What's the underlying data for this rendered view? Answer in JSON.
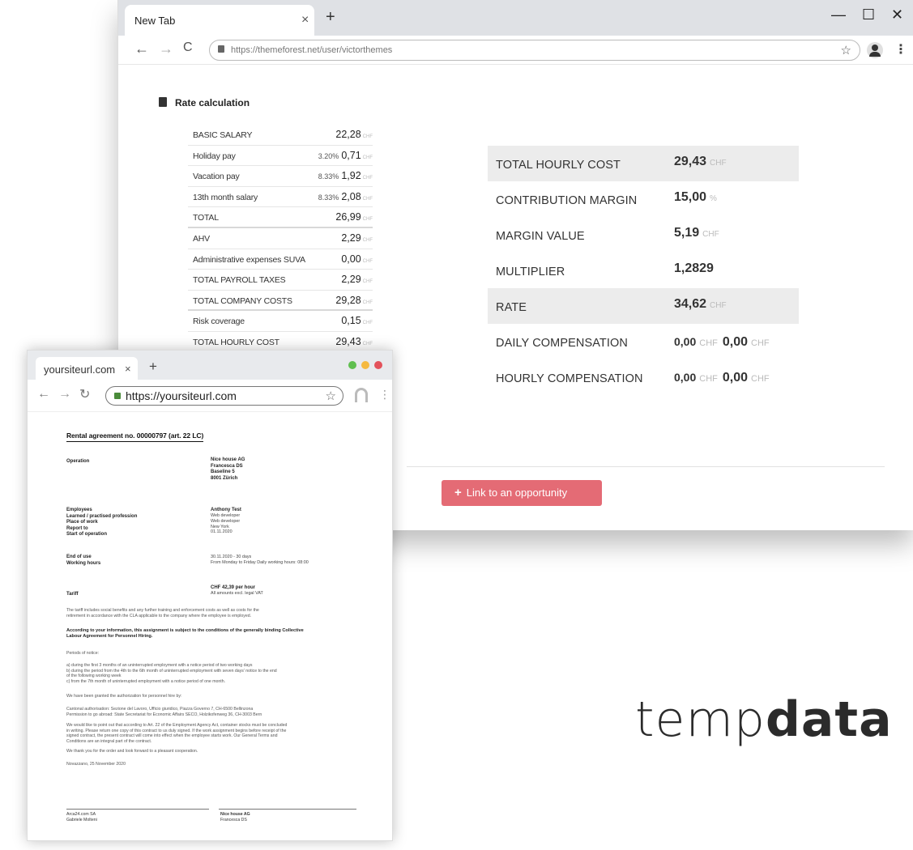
{
  "back_window": {
    "tab_title": "New Tab",
    "url": "https://themeforest.net/user/victorthemes",
    "controls": {
      "minimize": "—",
      "maximize": "☐",
      "close": "✕"
    },
    "rate_heading": "Rate calculation",
    "left_table": [
      {
        "label": "BASIC SALARY",
        "pct": "",
        "value": "22,28",
        "unit": "CHF"
      },
      {
        "label": "Holiday pay",
        "pct": "3.20%",
        "value": "0,71",
        "unit": "CHF"
      },
      {
        "label": "Vacation pay",
        "pct": "8.33%",
        "value": "1,92",
        "unit": "CHF"
      },
      {
        "label": "13th month salary",
        "pct": "8.33%",
        "value": "2,08",
        "unit": "CHF"
      },
      {
        "label": "TOTAL",
        "pct": "",
        "value": "26,99",
        "unit": "CHF"
      },
      {
        "label": "AHV",
        "pct": "",
        "value": "2,29",
        "unit": "CHF"
      },
      {
        "label": "Administrative expenses SUVA",
        "pct": "",
        "value": "0,00",
        "unit": "CHF"
      },
      {
        "label": "TOTAL PAYROLL TAXES",
        "pct": "",
        "value": "2,29",
        "unit": "CHF"
      },
      {
        "label": "TOTAL COMPANY COSTS",
        "pct": "",
        "value": "29,28",
        "unit": "CHF"
      },
      {
        "label": "Risk coverage",
        "pct": "",
        "value": "0,15",
        "unit": "CHF"
      },
      {
        "label": "TOTAL HOURLY COST",
        "pct": "",
        "value": "29,43",
        "unit": "CHF"
      }
    ],
    "right_table": [
      {
        "label": "TOTAL HOURLY COST",
        "value": "29,43",
        "unit": "CHF"
      },
      {
        "label": "CONTRIBUTION MARGIN",
        "value": "15,00",
        "unit": "%"
      },
      {
        "label": "MARGIN VALUE",
        "value": "5,19",
        "unit": "CHF"
      },
      {
        "label": "MULTIPLIER",
        "value": "1,2829",
        "unit": ""
      },
      {
        "label": "RATE",
        "value": "34,62",
        "unit": "CHF"
      },
      {
        "label": "DAILY COMPENSATION",
        "value": "0,00",
        "unit": "CHF",
        "value2": "0,00",
        "unit2": "CHF"
      },
      {
        "label": "HOURLY COMPENSATION",
        "value": "0,00",
        "unit": "CHF",
        "value2": "0,00",
        "unit2": "CHF"
      }
    ],
    "link_button": "Link to an opportunity"
  },
  "front_window": {
    "tab_title": "yoursiteurl.com",
    "url": "https://yoursiteurl.com",
    "doc": {
      "title": "Rental agreement no. 00000797 (art. 22 LC)",
      "operation_label": "Operation",
      "operation_value": "Nice house AG\nFrancesca DS\nBaseline 5\n8001 Zürich",
      "employee_labels": "Employees\nLearned / practised profession\nPlace of work\nReport to\nStart of operation",
      "employee_name": "Anthony Test",
      "employee_values": "Web developer\nWeb developer\nNew York\n01.11.2020",
      "end_label": "End of use\nWorking hours",
      "end_values": "30.11.2020 - 30 days\nFrom Monday to Friday Daily working hours: 08:00",
      "tariff_label": "Tariff",
      "tariff_value": "CHF 42,39 per hour",
      "tariff_note": "All amounts excl. legal VAT",
      "p1": "The tariff includes social benefits and any further training and enforcement costs as well as costs for the\nretirement in accordance with the CLA applicable to the company where the employee is employed.",
      "p2": "According to your information, this assignment is subject to the conditions of the generally binding Collective\nLabour Agreement for Personnel Hiring.",
      "p3": "Periods of notice:",
      "p4": "a) during the first 3 months of an uninterrupted employment with a notice period of two working days\nb) during the period from the 4th to the 6th month of uninterrupted employment with seven days' notice to the end\nof the following working week\nc) from the 7th month of uninterrupted employment with a notice period of one month.",
      "p5": "We have been granted the authorization for personnel hire by:",
      "p6": "Cantonal authorisation: Sezione del Lavoro, Ufficio giuridico, Piazza Governo 7, CH-6500 Bellinzona\nPermission to go abroad: State Secretariat for Economic Affairs SECO, Holzikofenweg 36, CH-3003 Bern",
      "p7": "We would like to point out that according to Art. 22 of the Employment Agency Act, container stocks must be concluded\nin writing. Please return one copy of this contract to us duly signed. If the work assignment begins before receipt of the\nsigned contract, the present contract will come into effect when the employee starts work. Our General Terms and\nConditions are an integral part of the contract.",
      "p8": "We thank you for the order and look forward to a pleasant cooperation.",
      "p9": "Novazzano, 25 November 2020",
      "sig_left": "Arca24.com SA\nGabriele Molteni",
      "sig_right_name": "Nice house AG",
      "sig_right_sub": "Francesca DS"
    }
  },
  "logo": {
    "part1": "temp",
    "part2": "data"
  },
  "colors": {
    "button": "#e46b75",
    "shaded_row": "#ececec",
    "dot_green": "#5fbf4f",
    "dot_yellow": "#f5b940",
    "dot_red": "#e3525b"
  }
}
